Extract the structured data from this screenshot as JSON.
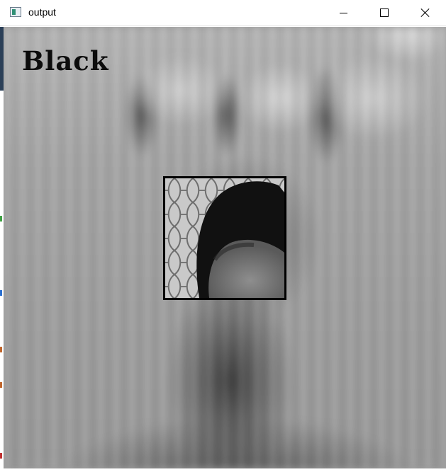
{
  "window": {
    "title": "output",
    "icon": "opencv-window-icon",
    "controls": {
      "minimize_icon": "minimize-icon",
      "maximize_icon": "maximize-icon",
      "close_icon": "close-icon"
    }
  },
  "frame": {
    "description_colors": {
      "overlay_text": "#0c0c0c",
      "box_stroke": "#000000"
    },
    "overlay_label": "Black"
  }
}
